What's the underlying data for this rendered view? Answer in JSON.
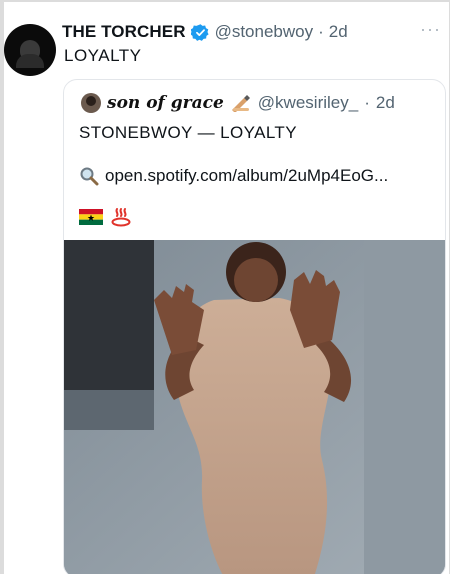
{
  "tweet": {
    "author_name": "THE TORCHER",
    "handle": "@stonebwoy",
    "separator": "·",
    "time": "2d",
    "text": "LOYALTY"
  },
  "quoted": {
    "author_name": "son of grace",
    "handle": "@kwesiriley_",
    "separator": "·",
    "time": "2d",
    "line1": "STONEBWOY — LOYALTY",
    "link": "open.spotify.com/album/2uMp4EoG..."
  },
  "icons": {
    "verified": "verified-badge-icon",
    "more": "more-options-icon",
    "pen": "writing-hand-icon",
    "search": "magnifying-glass-icon",
    "flag": "ghana-flag-icon",
    "hotspring": "hot-springs-icon"
  },
  "colors": {
    "verified": "#1d9bf0",
    "muted_text": "#536471",
    "text": "#0f1419"
  }
}
